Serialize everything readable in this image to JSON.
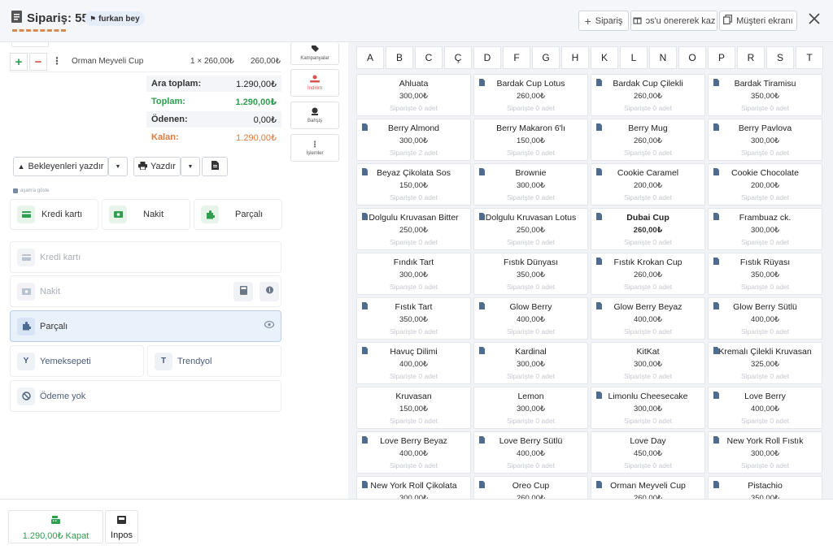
{
  "header": {
    "order_title": "Sipariş: 55",
    "customer": "furkan bey",
    "buttons": {
      "new_order": "Sipariş",
      "suggest": "ɔs'u önererek kaz",
      "customer_screen": "Müşteri ekranı"
    }
  },
  "cart": {
    "item": {
      "name": "Orman Meyveli Cup",
      "qty_price": "1 × 260,00₺",
      "total": "260,00₺"
    }
  },
  "summary": {
    "subtotal_label": "Ara toplam:",
    "subtotal": "1.290,00₺",
    "total_label": "Toplam:",
    "total": "1.290,00₺",
    "paid_label": "Ödenen:",
    "paid": "0,00₺",
    "remaining_label": "Kalan:",
    "remaining": "1.290,00₺"
  },
  "actions": {
    "print_pending": "Bekleyenleri yazdır",
    "print": "Yazdır"
  },
  "payment": {
    "hint": "aşam'a göste",
    "quick": [
      "Kredi kartı",
      "Nakit",
      "Parçalı"
    ],
    "methods": {
      "card": "Kredi kartı",
      "cash": "Nakit",
      "split": "Parçalı",
      "yemeksepeti_letter": "Y",
      "yemeksepeti": "Yemeksepeti",
      "trendyol_letter": "T",
      "trendyol": "Trendyol",
      "none": "Ödeme yok"
    }
  },
  "tools": [
    "Kampanyalar",
    "İndirim",
    "Bahşiş",
    "İşlemler"
  ],
  "alphabet": [
    "A",
    "B",
    "C",
    "Ç",
    "D",
    "F",
    "G",
    "H",
    "K",
    "L",
    "N",
    "O",
    "P",
    "R",
    "S",
    "T"
  ],
  "products": [
    {
      "name": "Ahluata",
      "price": "300,00₺",
      "count": "Siparişte 0 adet",
      "doc": false,
      "bold": false
    },
    {
      "name": "Bardak Cup Lotus",
      "price": "260,00₺",
      "count": "Siparişte 0 adet",
      "doc": true,
      "bold": false
    },
    {
      "name": "Bardak Cup Çilekli",
      "price": "260,00₺",
      "count": "Siparişte 0 adet",
      "doc": true,
      "bold": false
    },
    {
      "name": "Bardak Tiramisu",
      "price": "350,00₺",
      "count": "Siparişte 0 adet",
      "doc": true,
      "bold": false
    },
    {
      "name": "Berry Almond",
      "price": "300,00₺",
      "count": "Siparişte 2 adet",
      "doc": true,
      "bold": false
    },
    {
      "name": "Berry Makaron 6'lı",
      "price": "150,00₺",
      "count": "Siparişte 0 adet",
      "doc": false,
      "bold": false
    },
    {
      "name": "Berry Mug",
      "price": "260,00₺",
      "count": "Siparişte 0 adet",
      "doc": true,
      "bold": false
    },
    {
      "name": "Berry Pavlova",
      "price": "300,00₺",
      "count": "Siparişte 0 adet",
      "doc": true,
      "bold": false
    },
    {
      "name": "Beyaz Çikolata Sos",
      "price": "150,00₺",
      "count": "Siparişte 0 adet",
      "doc": true,
      "bold": false
    },
    {
      "name": "Brownie",
      "price": "300,00₺",
      "count": "Siparişte 0 adet",
      "doc": true,
      "bold": false
    },
    {
      "name": "Cookie Caramel",
      "price": "200,00₺",
      "count": "Siparişte 0 adet",
      "doc": true,
      "bold": false
    },
    {
      "name": "Cookie Chocolate",
      "price": "200,00₺",
      "count": "Siparişte 0 adet",
      "doc": true,
      "bold": false
    },
    {
      "name": "Dolgulu Kruvasan Bitter",
      "price": "250,00₺",
      "count": "Siparişte 0 adet",
      "doc": true,
      "bold": false
    },
    {
      "name": "Dolgulu Kruvasan Lotus",
      "price": "250,00₺",
      "count": "Siparişte 0 adet",
      "doc": true,
      "bold": false
    },
    {
      "name": "Dubai Cup",
      "price": "260,00₺",
      "count": "Siparişte 0 adet",
      "doc": true,
      "bold": true
    },
    {
      "name": "Frambuaz ck.",
      "price": "300,00₺",
      "count": "Siparişte 0 adet",
      "doc": true,
      "bold": false
    },
    {
      "name": "Fındık Tart",
      "price": "300,00₺",
      "count": "Siparişte 0 adet",
      "doc": false,
      "bold": false
    },
    {
      "name": "Fıstık Dünyası",
      "price": "350,00₺",
      "count": "Siparişte 0 adet",
      "doc": false,
      "bold": false
    },
    {
      "name": "Fıstık Krokan Cup",
      "price": "260,00₺",
      "count": "Siparişte 0 adet",
      "doc": true,
      "bold": false
    },
    {
      "name": "Fıstık Rüyası",
      "price": "350,00₺",
      "count": "Siparişte 0 adet",
      "doc": true,
      "bold": false
    },
    {
      "name": "Fıstık Tart",
      "price": "350,00₺",
      "count": "Siparişte 0 adet",
      "doc": true,
      "bold": false
    },
    {
      "name": "Glow Berry",
      "price": "400,00₺",
      "count": "Siparişte 0 adet",
      "doc": true,
      "bold": false
    },
    {
      "name": "Glow Berry Beyaz",
      "price": "400,00₺",
      "count": "Siparişte 0 adet",
      "doc": true,
      "bold": false
    },
    {
      "name": "Glow Berry Sütlü",
      "price": "400,00₺",
      "count": "Siparişte 0 adet",
      "doc": true,
      "bold": false
    },
    {
      "name": "Havuç Dilimi",
      "price": "400,00₺",
      "count": "Siparişte 0 adet",
      "doc": true,
      "bold": false
    },
    {
      "name": "Kardinal",
      "price": "300,00₺",
      "count": "Siparişte 0 adet",
      "doc": true,
      "bold": false
    },
    {
      "name": "KitKat",
      "price": "300,00₺",
      "count": "Siparişte 0 adet",
      "doc": false,
      "bold": false
    },
    {
      "name": "Kremalı Çilekli Kruvasan",
      "price": "325,00₺",
      "count": "Siparişte 0 adet",
      "doc": true,
      "bold": false
    },
    {
      "name": "Kruvasan",
      "price": "150,00₺",
      "count": "Siparişte 0 adet",
      "doc": false,
      "bold": false
    },
    {
      "name": "Lemon",
      "price": "300,00₺",
      "count": "Siparişte 0 adet",
      "doc": false,
      "bold": false
    },
    {
      "name": "Limonlu Cheesecake",
      "price": "300,00₺",
      "count": "Siparişte 0 adet",
      "doc": true,
      "bold": false
    },
    {
      "name": "Love Berry",
      "price": "400,00₺",
      "count": "Siparişte 0 adet",
      "doc": true,
      "bold": false
    },
    {
      "name": "Love Berry Beyaz",
      "price": "400,00₺",
      "count": "Siparişte 0 adet",
      "doc": true,
      "bold": false
    },
    {
      "name": "Love Berry Sütlü",
      "price": "400,00₺",
      "count": "Siparişte 0 adet",
      "doc": true,
      "bold": false
    },
    {
      "name": "Love Day",
      "price": "450,00₺",
      "count": "Siparişte 0 adet",
      "doc": false,
      "bold": false
    },
    {
      "name": "New York Roll Fıstık",
      "price": "300,00₺",
      "count": "Siparişte 0 adet",
      "doc": true,
      "bold": false
    },
    {
      "name": "New York Roll Çikolata",
      "price": "300,00₺",
      "count": "",
      "doc": true,
      "bold": false
    },
    {
      "name": "Oreo Cup",
      "price": "260,00₺",
      "count": "",
      "doc": true,
      "bold": false
    },
    {
      "name": "Orman Meyveli Cup",
      "price": "260,00₺",
      "count": "",
      "doc": true,
      "bold": false
    },
    {
      "name": "Pistachio",
      "price": "350,00₺",
      "count": "",
      "doc": true,
      "bold": false
    }
  ],
  "footer": {
    "close_label": "1.290,00₺ Kapat",
    "inpos_label": "Inpos"
  },
  "colors": {
    "green": "#2e9e4f",
    "orange": "#e07b39",
    "header_bg": "#f4f6f9",
    "grid_bg": "#f1f3f6",
    "selected": "#e9f1fb",
    "icon_blue": "#4e6b91"
  }
}
